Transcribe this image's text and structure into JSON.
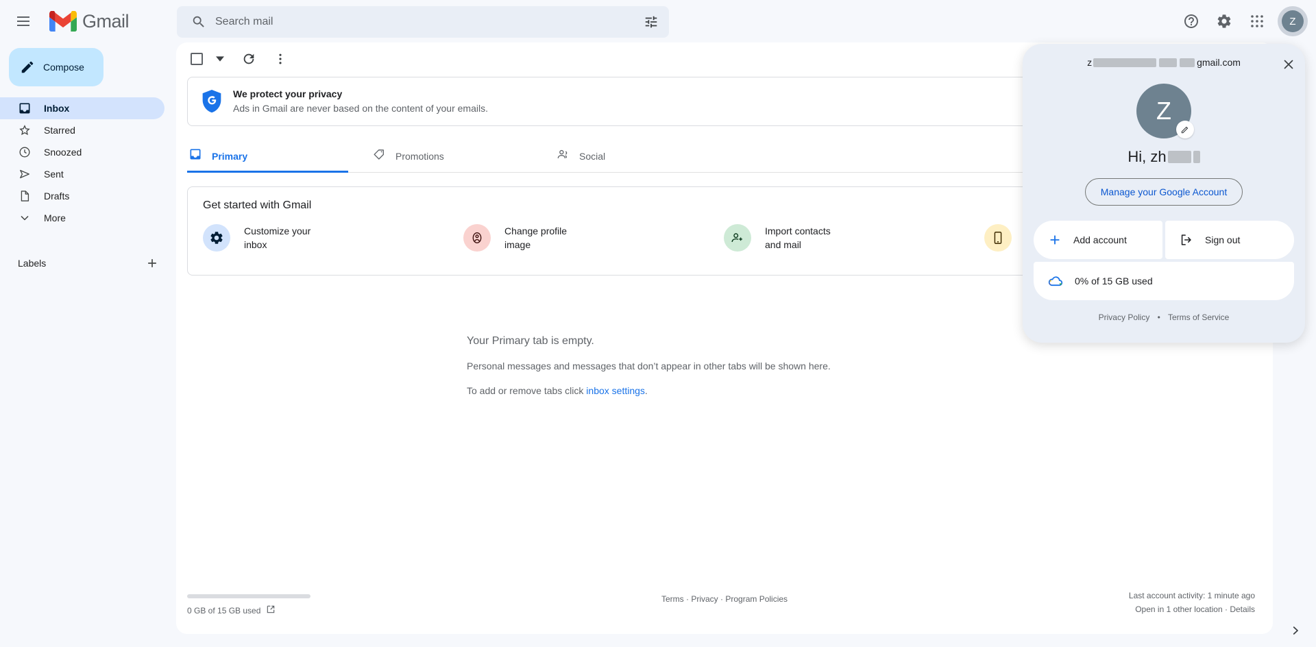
{
  "app": {
    "brand": "Gmail",
    "menu_icon": "hamburger-menu-icon",
    "logo_icon": "gmail-logo-icon"
  },
  "search": {
    "placeholder": "Search mail",
    "value": "",
    "icon": "search-icon",
    "options_icon": "search-options-icon"
  },
  "header_actions": {
    "help": "help-icon",
    "settings": "gear-icon",
    "apps": "google-apps-grid-icon",
    "avatar_letter": "Z"
  },
  "sidebar": {
    "compose_label": "Compose",
    "compose_icon": "pencil-icon",
    "items": [
      {
        "label": "Inbox",
        "icon": "inbox-icon",
        "active": true
      },
      {
        "label": "Starred",
        "icon": "star-icon",
        "active": false
      },
      {
        "label": "Snoozed",
        "icon": "clock-icon",
        "active": false
      },
      {
        "label": "Sent",
        "icon": "send-icon",
        "active": false
      },
      {
        "label": "Drafts",
        "icon": "document-icon",
        "active": false
      },
      {
        "label": "More",
        "icon": "chevron-down-icon",
        "active": false
      }
    ],
    "labels_title": "Labels",
    "labels_add_icon": "plus-icon"
  },
  "toolbar": {
    "select_all_icon": "checkbox-icon",
    "select_dropdown_icon": "caret-down-icon",
    "refresh_icon": "refresh-icon",
    "more_icon": "more-vertical-icon"
  },
  "privacy_banner": {
    "icon": "google-shield-icon",
    "title": "We protect your privacy",
    "subtitle": "Ads in Gmail are never based on the content of your emails."
  },
  "tabs": [
    {
      "label": "Primary",
      "icon": "inbox-tab-icon",
      "active": true
    },
    {
      "label": "Promotions",
      "icon": "tag-icon",
      "active": false
    },
    {
      "label": "Social",
      "icon": "people-icon",
      "active": false
    }
  ],
  "get_started": {
    "title": "Get started with Gmail",
    "items": [
      {
        "line1": "Customize your",
        "line2": "inbox",
        "icon": "gear-icon",
        "bubble": "#d2e3fc"
      },
      {
        "line1": "Change profile",
        "line2": "image",
        "icon": "profile-icon",
        "bubble": "#fad2cf"
      },
      {
        "line1": "Import contacts",
        "line2": "and mail",
        "icon": "add-person-icon",
        "bubble": "#ceead6"
      },
      {
        "line1": "",
        "line2": "",
        "icon": "mobile-phone-icon",
        "bubble": "#feefc3"
      }
    ]
  },
  "empty_state": {
    "line1": "Your Primary tab is empty.",
    "line2": "Personal messages and messages that don’t appear in other tabs will be shown here.",
    "line3_prefix": "To add or remove tabs click ",
    "line3_link": "inbox settings",
    "line3_suffix": "."
  },
  "footer": {
    "storage_text": "0 GB of 15 GB used",
    "storage_icon": "open-in-new-icon",
    "storage_percent": 0,
    "terms": "Terms",
    "privacy": "Privacy",
    "program_policies": "Program Policies",
    "separator": "·",
    "last_activity": "Last account activity: 1 minute ago",
    "open_location_prefix": "Open in 1 other location · ",
    "details_link": "Details",
    "chevron_icon": "chevron-right-icon"
  },
  "account_popup": {
    "email_prefix": "z",
    "email_suffix": "gmail.com",
    "close_icon": "close-icon",
    "avatar_letter": "Z",
    "avatar_color": "#6e8290",
    "edit_icon": "pencil-icon",
    "greeting_prefix": "Hi, zh",
    "manage_label": "Manage your Google Account",
    "manage_color": "#0b57d0",
    "add_account_label": "Add account",
    "add_account_icon": "plus-icon",
    "sign_out_label": "Sign out",
    "sign_out_icon": "logout-icon",
    "storage_label": "0% of 15 GB used",
    "storage_icon": "google-drive-cloud-icon",
    "privacy_policy": "Privacy Policy",
    "terms_of_service": "Terms of Service",
    "footer_separator": "•"
  },
  "colors": {
    "background": "#f6f8fc",
    "panel": "#ffffff",
    "accent": "#1a73e8",
    "compose": "#c2e7ff",
    "active_nav": "#d3e3fd",
    "popup_bg": "#e9eef6"
  }
}
